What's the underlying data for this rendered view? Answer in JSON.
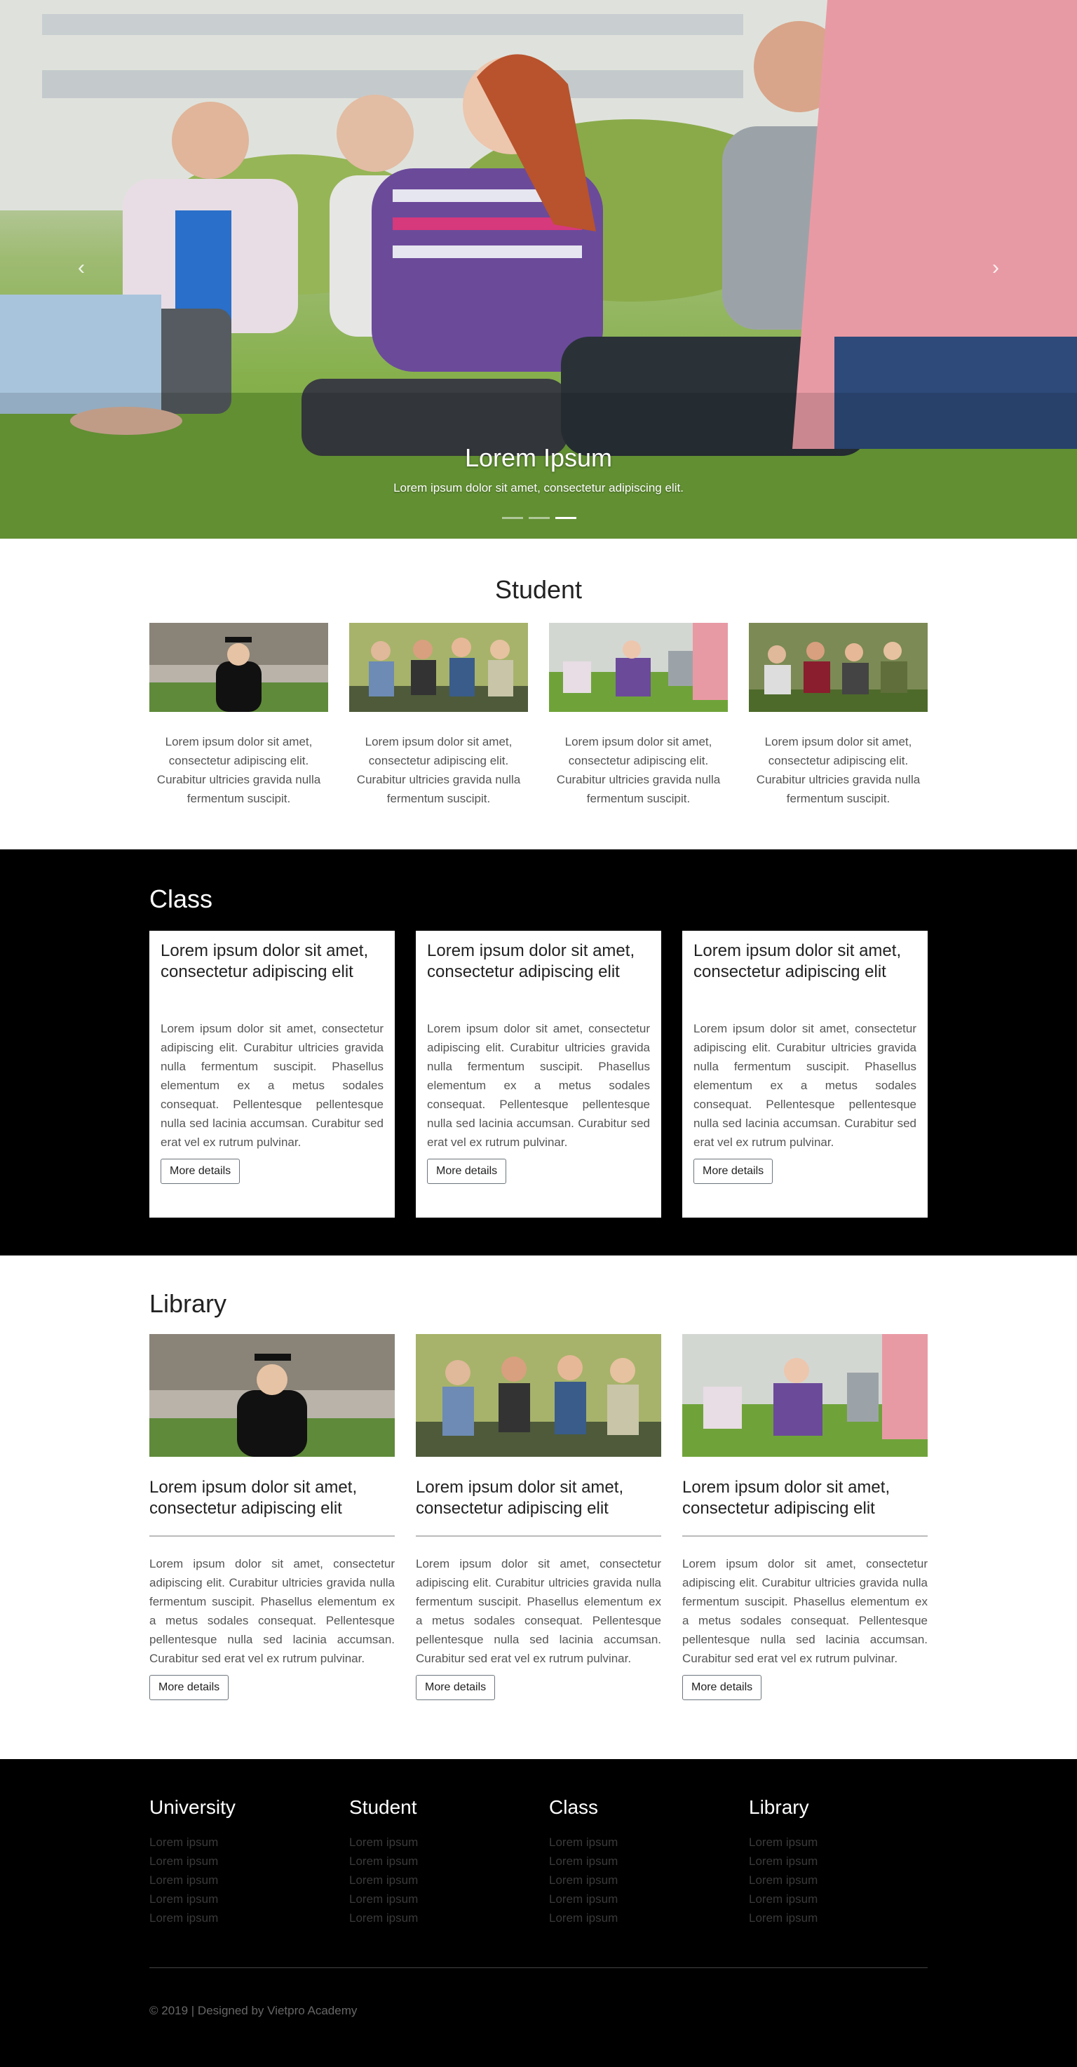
{
  "hero": {
    "title": "Lorem Ipsum",
    "subtitle": "Lorem ipsum dolor sit amet, consectetur adipiscing elit.",
    "prev_glyph": "‹",
    "next_glyph": "›",
    "slide_count": 3,
    "active_slide": 3
  },
  "student": {
    "heading": "Student",
    "cards": [
      {
        "text": "Lorem ipsum dolor sit amet, consectetur adipiscing elit. Curabitur ultricies gravida nulla fermentum suscipit."
      },
      {
        "text": "Lorem ipsum dolor sit amet, consectetur adipiscing elit. Curabitur ultricies gravida nulla fermentum suscipit."
      },
      {
        "text": "Lorem ipsum dolor sit amet, consectetur adipiscing elit. Curabitur ultricies gravida nulla fermentum suscipit."
      },
      {
        "text": "Lorem ipsum dolor sit amet, consectetur adipiscing elit. Curabitur ultricies gravida nulla fermentum suscipit."
      }
    ]
  },
  "class_section": {
    "heading": "Class",
    "cards": [
      {
        "title": "Lorem ipsum dolor sit amet, consectetur adipiscing elit",
        "text": "Lorem ipsum dolor sit amet, consectetur adipiscing elit. Curabitur ultricies gravida nulla fermentum suscipit. Phasellus elementum ex a metus sodales consequat. Pellentesque pellentesque nulla sed lacinia accumsan. Curabitur sed erat vel ex rutrum pulvinar.",
        "button": "More details"
      },
      {
        "title": "Lorem ipsum dolor sit amet, consectetur adipiscing elit",
        "text": "Lorem ipsum dolor sit amet, consectetur adipiscing elit. Curabitur ultricies gravida nulla fermentum suscipit. Phasellus elementum ex a metus sodales consequat. Pellentesque pellentesque nulla sed lacinia accumsan. Curabitur sed erat vel ex rutrum pulvinar.",
        "button": "More details"
      },
      {
        "title": "Lorem ipsum dolor sit amet, consectetur adipiscing elit",
        "text": "Lorem ipsum dolor sit amet, consectetur adipiscing elit. Curabitur ultricies gravida nulla fermentum suscipit. Phasellus elementum ex a metus sodales consequat. Pellentesque pellentesque nulla sed lacinia accumsan. Curabitur sed erat vel ex rutrum pulvinar.",
        "button": "More details"
      }
    ]
  },
  "library": {
    "heading": "Library",
    "cards": [
      {
        "title": "Lorem ipsum dolor sit amet, consectetur adipiscing elit",
        "text": "Lorem ipsum dolor sit amet, consectetur adipiscing elit. Curabitur ultricies gravida nulla fermentum suscipit. Phasellus elementum ex a metus sodales consequat. Pellentesque pellentesque nulla sed lacinia accumsan. Curabitur sed erat vel ex rutrum pulvinar.",
        "button": "More details"
      },
      {
        "title": "Lorem ipsum dolor sit amet, consectetur adipiscing elit",
        "text": "Lorem ipsum dolor sit amet, consectetur adipiscing elit. Curabitur ultricies gravida nulla fermentum suscipit. Phasellus elementum ex a metus sodales consequat. Pellentesque pellentesque nulla sed lacinia accumsan. Curabitur sed erat vel ex rutrum pulvinar.",
        "button": "More details"
      },
      {
        "title": "Lorem ipsum dolor sit amet, consectetur adipiscing elit",
        "text": "Lorem ipsum dolor sit amet, consectetur adipiscing elit. Curabitur ultricies gravida nulla fermentum suscipit. Phasellus elementum ex a metus sodales consequat. Pellentesque pellentesque nulla sed lacinia accumsan. Curabitur sed erat vel ex rutrum pulvinar.",
        "button": "More details"
      }
    ]
  },
  "footer": {
    "columns": [
      {
        "heading": "University",
        "links": [
          "Lorem ipsum",
          "Lorem ipsum",
          "Lorem ipsum",
          "Lorem ipsum",
          "Lorem ipsum"
        ]
      },
      {
        "heading": "Student",
        "links": [
          "Lorem ipsum",
          "Lorem ipsum",
          "Lorem ipsum",
          "Lorem ipsum",
          "Lorem ipsum"
        ]
      },
      {
        "heading": "Class",
        "links": [
          "Lorem ipsum",
          "Lorem ipsum",
          "Lorem ipsum",
          "Lorem ipsum",
          "Lorem ipsum"
        ]
      },
      {
        "heading": "Library",
        "links": [
          "Lorem ipsum",
          "Lorem ipsum",
          "Lorem ipsum",
          "Lorem ipsum",
          "Lorem ipsum"
        ]
      }
    ],
    "copyright": "© 2019 | Designed by Vietpro Academy"
  }
}
